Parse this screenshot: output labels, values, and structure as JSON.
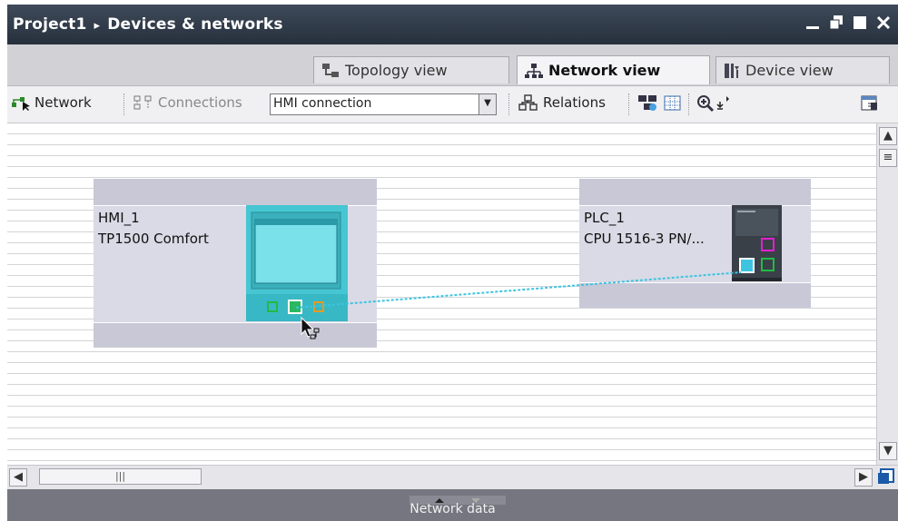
{
  "window": {
    "breadcrumb_project": "Project1",
    "breadcrumb_separator": "▸",
    "breadcrumb_page": "Devices & networks"
  },
  "tabs": [
    {
      "label": "Topology view",
      "icon": "topology-view-icon",
      "active": false
    },
    {
      "label": "Network view",
      "icon": "network-view-icon",
      "active": true
    },
    {
      "label": "Device view",
      "icon": "device-view-icon",
      "active": false
    }
  ],
  "toolbar": {
    "network_label": "Network",
    "connections_label": "Connections",
    "connection_type_value": "HMI connection",
    "relations_label": "Relations"
  },
  "devices": [
    {
      "name": "HMI_1",
      "type": "TP1500 Comfort"
    },
    {
      "name": "PLC_1",
      "type": "CPU 1516-3 PN/..."
    }
  ],
  "bottom_panel": {
    "label": "Network data"
  },
  "colors": {
    "title_bar": "#2e3846",
    "device_box": "#c8c8d6",
    "hmi_body": "#48c8d4",
    "plc_body": "#3a4048",
    "connection_line": "#3cc4e0",
    "port_green": "#22bb44",
    "port_orange": "#e89a20",
    "port_magenta": "#e020d0"
  }
}
